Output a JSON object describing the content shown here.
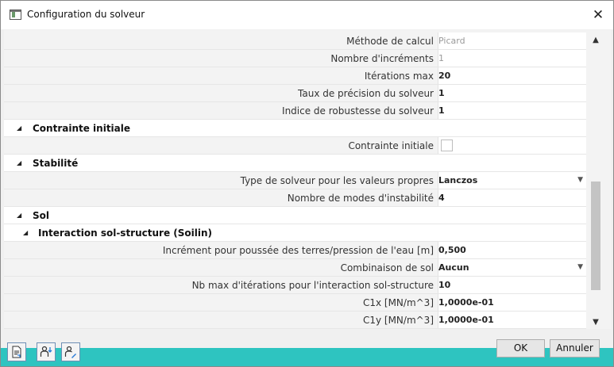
{
  "window": {
    "title": "Configuration du solveur"
  },
  "rows": [
    {
      "label": "Méthode de calcul",
      "value": "Picard"
    },
    {
      "label": "Nombre d'incréments",
      "value": "1"
    },
    {
      "label": "Itérations max",
      "value": "20"
    },
    {
      "label": "Taux de précision du solveur",
      "value": "1"
    },
    {
      "label": "Indice de robustesse du solveur",
      "value": "1"
    }
  ],
  "groups": {
    "contrainte": {
      "title": "Contrainte initiale",
      "rows": [
        {
          "label": "Contrainte initiale",
          "checked": false
        }
      ]
    },
    "stabilite": {
      "title": "Stabilité",
      "rows": [
        {
          "label": "Type de solveur pour les valeurs propres",
          "value": "Lanczos"
        },
        {
          "label": "Nombre de modes d'instabilité",
          "value": "4"
        }
      ]
    },
    "sol": {
      "title": "Sol",
      "subgroup": {
        "title": "Interaction sol-structure (Soilin)",
        "rows": [
          {
            "label": "Incrément pour poussée des terres/pression de l'eau [m]",
            "value": "0,500"
          },
          {
            "label": "Combinaison de sol",
            "value": "Aucun"
          },
          {
            "label": "Nb max d'itérations pour l'interaction sol-structure",
            "value": "10"
          },
          {
            "label": "C1x [MN/m^3]",
            "value": "1,0000e-01"
          },
          {
            "label": "C1y [MN/m^3]",
            "value": "1,0000e-01"
          }
        ]
      }
    }
  },
  "footer": {
    "ok_label": "OK",
    "cancel_label": "Annuler"
  },
  "icons": {
    "close": "close-icon",
    "collapse": "collapse-triangle-icon",
    "dropdown": "chevron-down-icon"
  }
}
